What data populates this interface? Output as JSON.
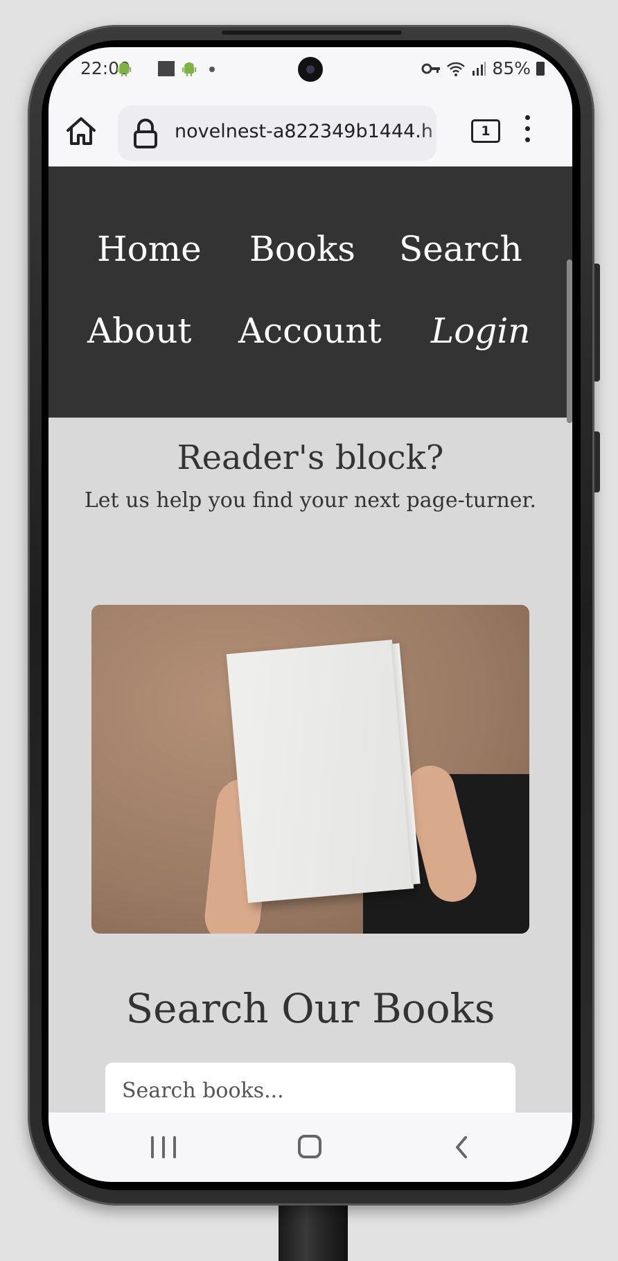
{
  "status_bar": {
    "time": "22:00",
    "battery": "85%",
    "icons": [
      "android-icon",
      "square-icon",
      "android-icon",
      "dot-icon",
      "key-icon",
      "wifi-icon",
      "signal-icon",
      "battery-icon"
    ]
  },
  "browser": {
    "url": "novelnest-a822349b1444.h",
    "tab_count": "1"
  },
  "nav": {
    "items": [
      "Home",
      "Books",
      "Search",
      "About",
      "Account",
      "Login"
    ]
  },
  "hero": {
    "title": "Reader's block?",
    "subtitle": "Let us help you find your next page-turner."
  },
  "search": {
    "title": "Search Our Books",
    "placeholder": "Search books..."
  },
  "colors": {
    "nav_bg": "#333333",
    "page_bg": "#d9d9d9",
    "text": "#333333"
  }
}
